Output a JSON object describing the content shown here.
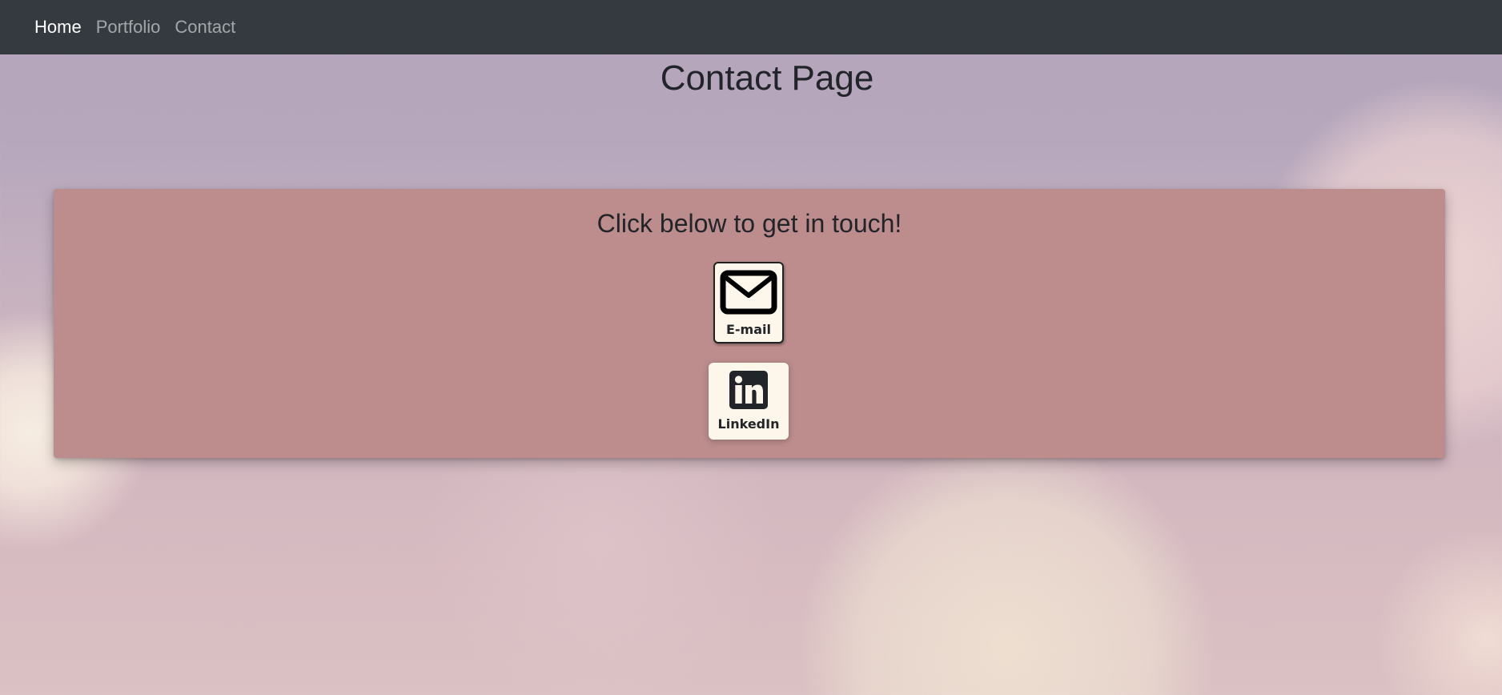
{
  "nav": {
    "items": [
      {
        "label": "Home",
        "active": true
      },
      {
        "label": "Portfolio",
        "active": false
      },
      {
        "label": "Contact",
        "active": false
      }
    ]
  },
  "main": {
    "title": "Contact Page",
    "card": {
      "heading": "Click below to get in touch!",
      "buttons": [
        {
          "label": "E-mail",
          "icon": "envelope-icon"
        },
        {
          "label": "LinkedIn",
          "icon": "linkedin-icon"
        }
      ]
    }
  },
  "colors": {
    "navbar": "#343a40",
    "card": "#bc8d8c",
    "button_bg": "#fdf6ea",
    "text": "#212529"
  }
}
